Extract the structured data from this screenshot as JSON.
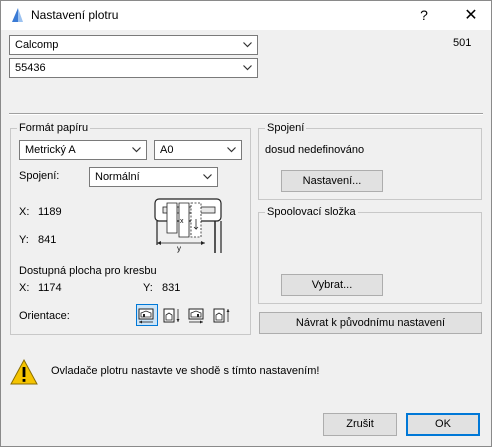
{
  "window": {
    "title": "Nastavení plotru",
    "help_glyph": "?",
    "close_glyph": "✕"
  },
  "top": {
    "driver_value": "Calcomp",
    "model_value": "55436",
    "code": "501"
  },
  "paper": {
    "group_label": "Formát papíru",
    "unit_value": "Metrický A",
    "size_value": "A0",
    "connection_label": "Spojení:",
    "connection_value": "Normální",
    "x_label": "X:",
    "x_value": "1189",
    "y_label": "Y:",
    "y_value": "841",
    "available_title": "Dostupná plocha pro kresbu",
    "ax_label": "X:",
    "ax_value": "1174",
    "ay_label": "Y:",
    "ay_value": "831",
    "orientation_label": "Orientace:"
  },
  "connection": {
    "group_label": "Spojení",
    "status": "dosud nedefinováno",
    "settings_button": "Nastavení..."
  },
  "spool": {
    "group_label": "Spoolovací složka",
    "select_button": "Vybrat..."
  },
  "restore_button": "Návrat k původnímu nastavení",
  "warning_text": "Ovladače plotru nastavte ve shodě s tímto nastavením!",
  "footer": {
    "cancel_label": "Zrušit",
    "ok_label": "OK"
  },
  "icons": {
    "app": "plotter-app-icon",
    "warning": "warning-icon",
    "plotter": "plotter-illustration",
    "orientations": [
      "orientation-1-icon",
      "orientation-2-icon",
      "orientation-3-icon",
      "orientation-4-icon"
    ]
  },
  "colors": {
    "accent": "#0078d7",
    "warning": "#f5c400"
  }
}
